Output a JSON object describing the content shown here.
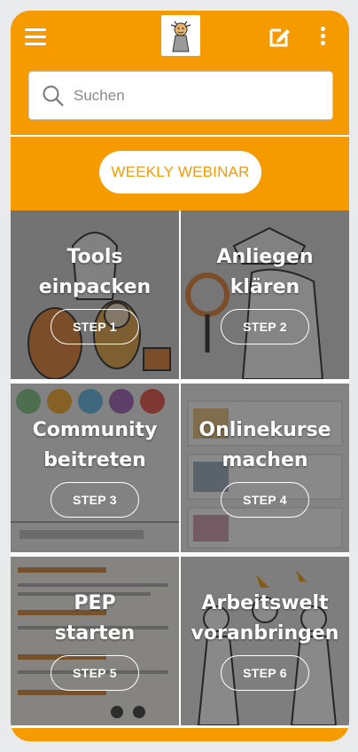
{
  "header": {
    "menu_icon": "hamburger-icon",
    "logo_icon": "mascot-logo",
    "edit_icon": "edit-icon",
    "more_icon": "more-vertical-icon"
  },
  "search": {
    "placeholder": "Suchen",
    "value": ""
  },
  "webinar": {
    "label": "WEEKLY WEBINAR"
  },
  "tiles": [
    {
      "title_line1": "Tools",
      "title_line2": "einpacken",
      "step": "STEP 1"
    },
    {
      "title_line1": "Anliegen",
      "title_line2": "klären",
      "step": "STEP 2"
    },
    {
      "title_line1": "Community",
      "title_line2": "beitreten",
      "step": "STEP 3"
    },
    {
      "title_line1": "Onlinekurse",
      "title_line2": "machen",
      "step": "STEP 4"
    },
    {
      "title_line1": "PEP",
      "title_line2": "starten",
      "step": "STEP 5"
    },
    {
      "title_line1": "Arbeitswelt",
      "title_line2": "voranbringen",
      "step": "STEP 6"
    }
  ],
  "colors": {
    "accent": "#f59b00",
    "white": "#ffffff"
  }
}
